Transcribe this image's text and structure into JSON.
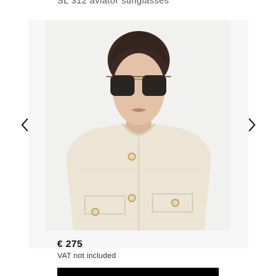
{
  "product": {
    "title": "SL 312 aviator sunglasses",
    "price": "€ 275",
    "vat_note": "VAT not included"
  },
  "gallery": {
    "prev_icon": "chevron-left-icon",
    "next_icon": "chevron-right-icon"
  },
  "colors": {
    "cta": "#000000",
    "background": "#ffffff",
    "image_bg": "#f1f1f0",
    "jacket": "#ece5d3"
  }
}
